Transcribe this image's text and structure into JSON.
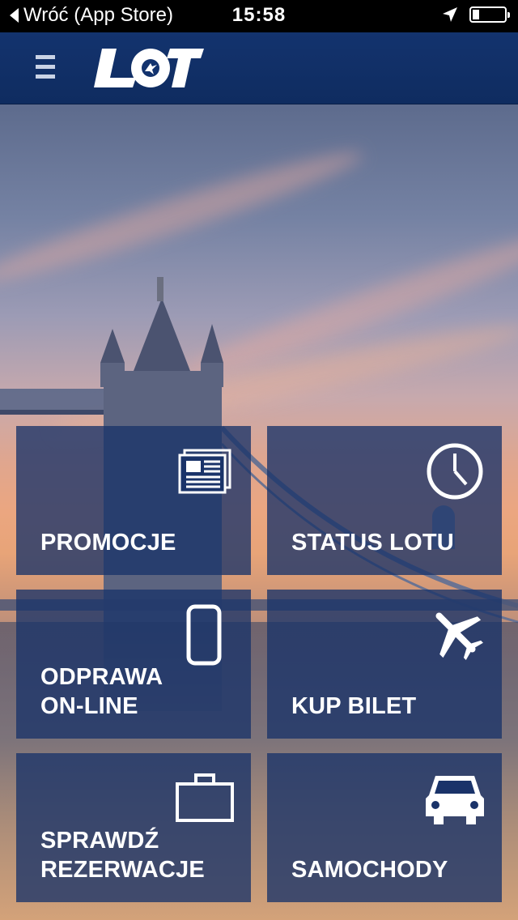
{
  "status_bar": {
    "back_label": "Wróć (App Store)",
    "time": "15:58",
    "icons": [
      "location-arrow-icon",
      "battery-icon"
    ],
    "battery_level": 0.15
  },
  "header": {
    "logo_text": "LOT",
    "menu_icon": "hamburger-menu-icon"
  },
  "colors": {
    "header_bg": "#13336e",
    "tile_bg": "#1a3369",
    "text": "#ffffff"
  },
  "tiles": [
    {
      "label": "PROMOCJE",
      "icon": "newspaper-icon"
    },
    {
      "label": "STATUS LOTU",
      "icon": "clock-icon"
    },
    {
      "label": "ODPRAWA\nON-LINE",
      "icon": "smartphone-icon"
    },
    {
      "label": "KUP BILET",
      "icon": "airplane-icon"
    },
    {
      "label": "SPRAWDŹ\nREZERWACJE",
      "icon": "briefcase-icon"
    },
    {
      "label": "SAMOCHODY",
      "icon": "car-icon"
    }
  ]
}
